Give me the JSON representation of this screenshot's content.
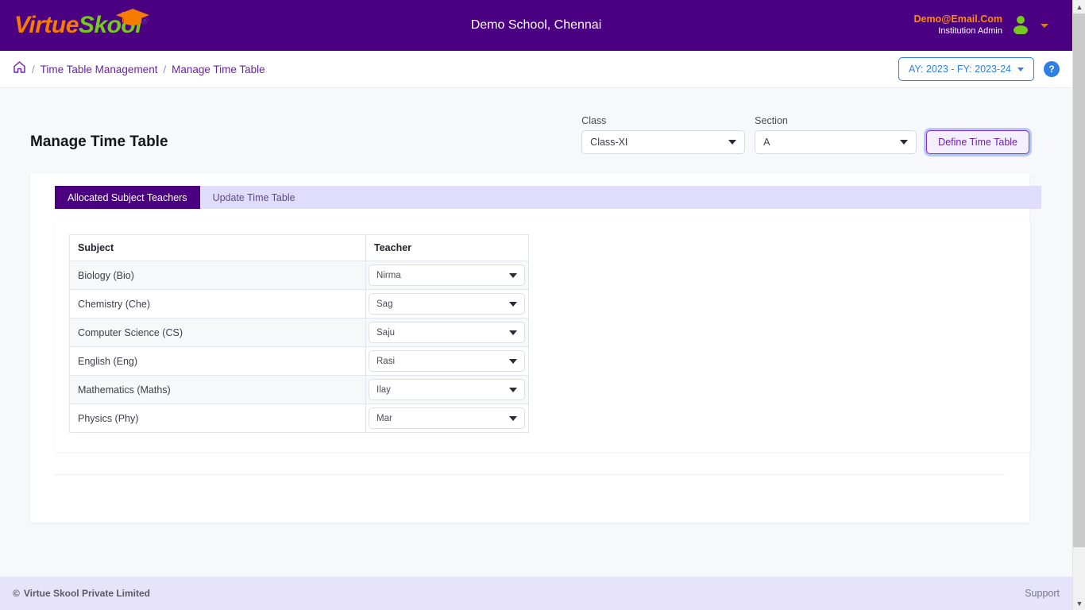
{
  "header": {
    "logo_virtue": "Virtue",
    "logo_skool": "Skool",
    "logo_reg": "®",
    "school_name": "Demo School, Chennai",
    "user_email": "Demo@Email.Com",
    "user_role": "Institution Admin"
  },
  "breadcrumb": {
    "home_icon": "home-icon",
    "sep": "/",
    "parent": "Time Table Management",
    "current": "Manage Time Table",
    "academic_year": "AY: 2023 - FY: 2023-24",
    "help": "?"
  },
  "page": {
    "title": "Manage Time Table",
    "class_label": "Class",
    "class_value": "Class-XI",
    "section_label": "Section",
    "section_value": "A",
    "define_button": "Define Time Table"
  },
  "tabs": [
    {
      "label": "Allocated Subject Teachers",
      "active": true
    },
    {
      "label": "Update Time Table",
      "active": false
    }
  ],
  "table": {
    "columns": [
      "Subject",
      "Teacher"
    ],
    "rows": [
      {
        "subject": "Biology (Bio)",
        "teacher": "Nirma"
      },
      {
        "subject": "Chemistry (Che)",
        "teacher": "Sag"
      },
      {
        "subject": "Computer Science (CS)",
        "teacher": "Saju"
      },
      {
        "subject": "English (Eng)",
        "teacher": "Rasi"
      },
      {
        "subject": "Mathematics (Maths)",
        "teacher": "Ilay"
      },
      {
        "subject": "Physics (Phy)",
        "teacher": "Mar"
      }
    ]
  },
  "footer": {
    "copyright_symbol": "©",
    "copyright": "Virtue Skool Private Limited",
    "support": "Support"
  },
  "colors": {
    "brand_purple": "#4B0082",
    "logo_orange": "#F57C00",
    "logo_green": "#76C81E",
    "accent_blue": "#2F7FE4",
    "tabbar_lavender": "#E0DCFB"
  }
}
